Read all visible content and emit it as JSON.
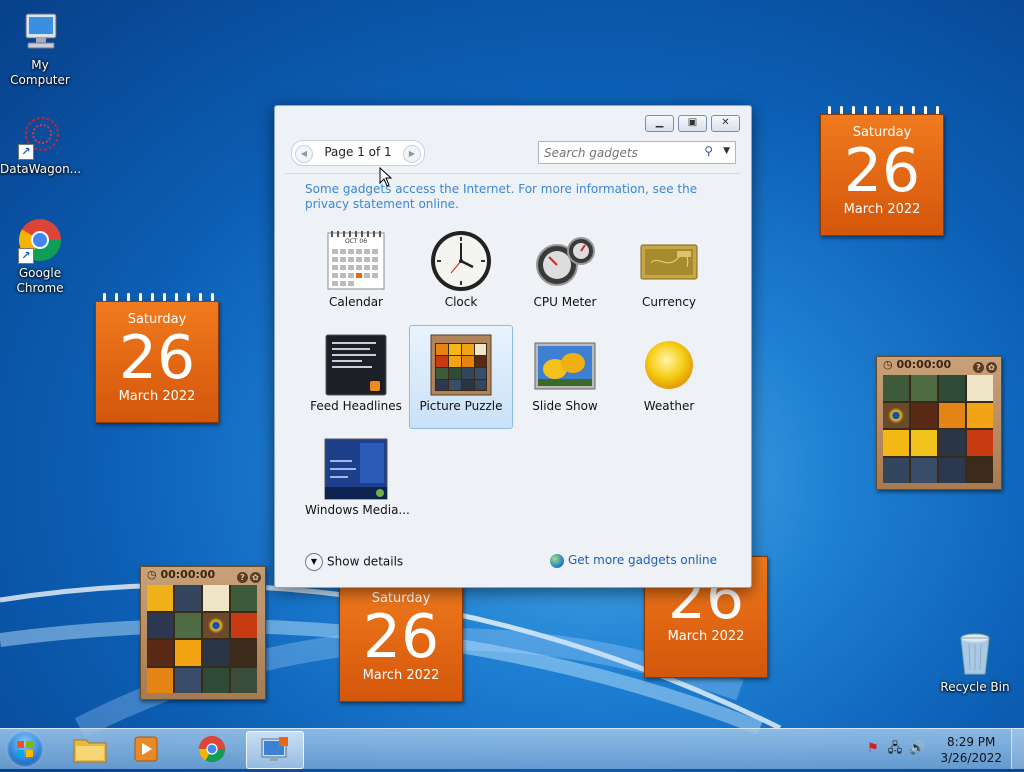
{
  "desktop": {
    "icons": [
      {
        "label": "My Computer"
      },
      {
        "label": "DataWagon..."
      },
      {
        "label": "Google Chrome"
      },
      {
        "label": "Recycle Bin"
      }
    ]
  },
  "calendars": [
    {
      "weekday": "Saturday",
      "day": "26",
      "month": "March 2022"
    },
    {
      "weekday": "Saturday",
      "day": "26",
      "month": "March 2022"
    },
    {
      "weekday": "Saturday",
      "day": "26",
      "month": "March 2022"
    },
    {
      "weekday": "",
      "day": "26",
      "month": "March 2022"
    }
  ],
  "puzzles": [
    {
      "timer": "00:00:00"
    },
    {
      "timer": "00:00:00"
    }
  ],
  "gadget_window": {
    "page_label": "Page 1 of 1",
    "search_placeholder": "Search gadgets",
    "notice": "Some gadgets access the Internet.  For more information, see the privacy statement online.",
    "gadgets": [
      {
        "label": "Calendar"
      },
      {
        "label": "Clock"
      },
      {
        "label": "CPU Meter"
      },
      {
        "label": "Currency"
      },
      {
        "label": "Feed Headlines"
      },
      {
        "label": "Picture Puzzle",
        "selected": true
      },
      {
        "label": "Slide Show"
      },
      {
        "label": "Weather"
      },
      {
        "label": "Windows Media..."
      }
    ],
    "calendar_thumb_month": "OCT 06",
    "show_details": "Show details",
    "get_more": "Get more gadgets online"
  },
  "taskbar": {
    "time": "8:29 PM",
    "date": "3/26/2022"
  },
  "colors": {
    "calendar_orange": "#e8690f",
    "link_blue": "#3a86d8",
    "selection_blue": "#c9e1f8"
  }
}
